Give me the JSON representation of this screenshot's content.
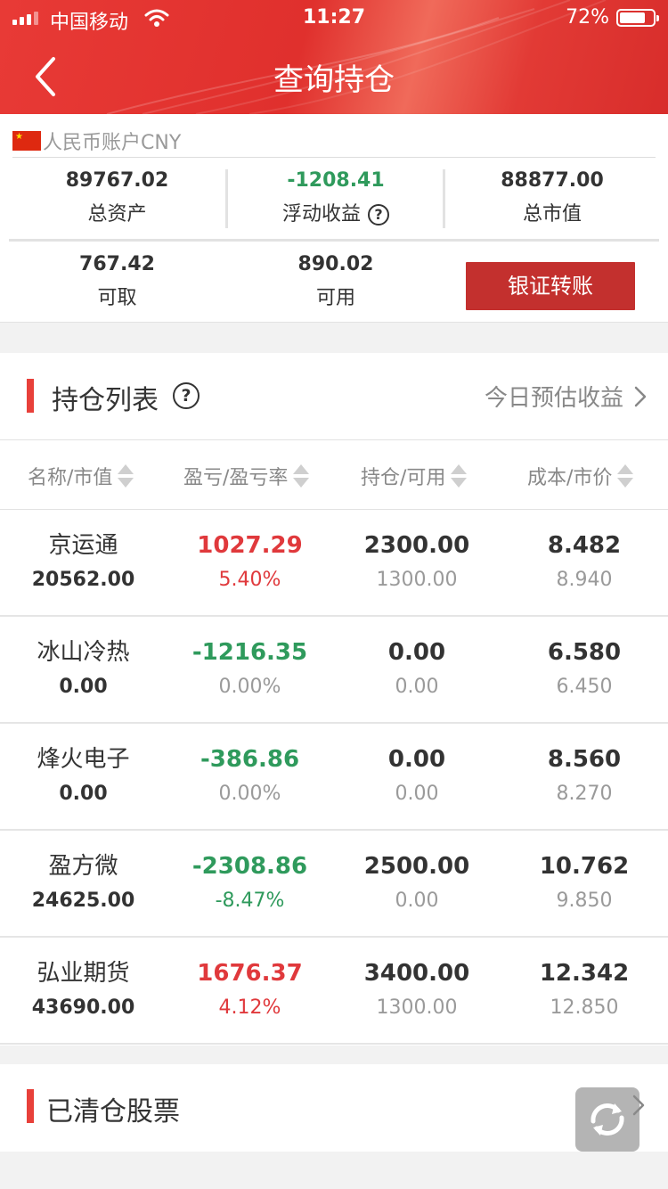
{
  "status_bar": {
    "carrier": "中国移动",
    "time": "11:27",
    "battery": "72%"
  },
  "nav": {
    "title": "查询持仓"
  },
  "account": {
    "label": "人民币账户CNY",
    "total_assets": {
      "value": "89767.02",
      "label": "总资产"
    },
    "floating_pnl": {
      "value": "-1208.41",
      "label": "浮动收益"
    },
    "market_value": {
      "value": "88877.00",
      "label": "总市值"
    },
    "withdrawable": {
      "value": "767.42",
      "label": "可取"
    },
    "available": {
      "value": "890.02",
      "label": "可用"
    },
    "transfer_button": "银证转账",
    "help_glyph": "?"
  },
  "holdings": {
    "title": "持仓列表",
    "help_glyph": "?",
    "estimate_link": "今日预估收益",
    "columns": [
      "名称/市值",
      "盈亏/盈亏率",
      "持仓/可用",
      "成本/市价"
    ],
    "rows": [
      {
        "name": "京运通",
        "market_value": "20562.00",
        "pnl": "1027.29",
        "pnl_rate": "5.40%",
        "position": "2300.00",
        "available": "1300.00",
        "cost": "8.482",
        "price": "8.940",
        "trend": "up",
        "rate_colored": true
      },
      {
        "name": "冰山冷热",
        "market_value": "0.00",
        "pnl": "-1216.35",
        "pnl_rate": "0.00%",
        "position": "0.00",
        "available": "0.00",
        "cost": "6.580",
        "price": "6.450",
        "trend": "down",
        "rate_colored": false
      },
      {
        "name": "烽火电子",
        "market_value": "0.00",
        "pnl": "-386.86",
        "pnl_rate": "0.00%",
        "position": "0.00",
        "available": "0.00",
        "cost": "8.560",
        "price": "8.270",
        "trend": "down",
        "rate_colored": false
      },
      {
        "name": "盈方微",
        "market_value": "24625.00",
        "pnl": "-2308.86",
        "pnl_rate": "-8.47%",
        "position": "2500.00",
        "available": "0.00",
        "cost": "10.762",
        "price": "9.850",
        "trend": "down",
        "rate_colored": true
      },
      {
        "name": "弘业期货",
        "market_value": "43690.00",
        "pnl": "1676.37",
        "pnl_rate": "4.12%",
        "position": "3400.00",
        "available": "1300.00",
        "cost": "12.342",
        "price": "12.850",
        "trend": "up",
        "rate_colored": true
      }
    ]
  },
  "cleared": {
    "title": "已清仓股票"
  },
  "colors": {
    "brand_red": "#e0302d",
    "button_red": "#c3302e",
    "profit_red": "#e0393c",
    "loss_green": "#2f9a5c"
  },
  "icons": [
    "back-arrow-icon",
    "wifi-icon",
    "battery-icon",
    "cn-flag-icon",
    "help-icon",
    "chevron-right-icon",
    "sort-icon",
    "refresh-icon"
  ]
}
